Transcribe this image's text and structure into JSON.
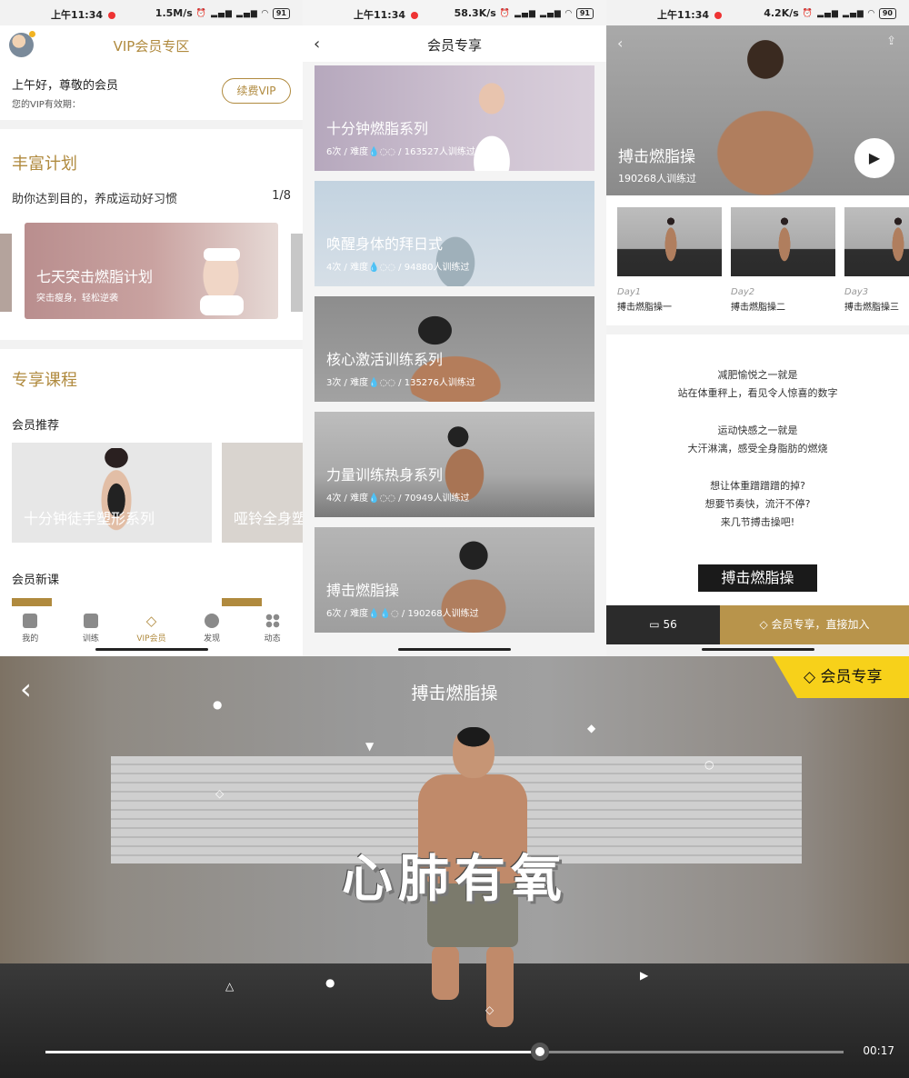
{
  "status": [
    {
      "time": "上午11:34",
      "speed": "1.5M/s",
      "battery": "91"
    },
    {
      "time": "上午11:34",
      "speed": "58.3K/s",
      "battery": "91"
    },
    {
      "time": "上午11:34",
      "speed": "4.2K/s",
      "battery": "90"
    }
  ],
  "p1": {
    "title": "VIP会员专区",
    "greeting": "上午好，尊敬的会员",
    "validity": "您的VIP有效期：",
    "renew": "续费VIP",
    "plans_title": "丰富计划",
    "plans_subtitle": "助你达到目的，养成运动好习惯",
    "plans_count": "1/8",
    "plan": {
      "title": "七天突击燃脂计划",
      "subtitle": "突击瘦身，轻松逆袭"
    },
    "courses_title": "专享课程",
    "recommend_label": "会员推荐",
    "recommend": [
      {
        "title": "十分钟徒手塑形系列"
      },
      {
        "title": "哑铃全身塑"
      }
    ],
    "new_label": "会员新课",
    "tabs": [
      {
        "label": "我的",
        "icon": "person-icon"
      },
      {
        "label": "训练",
        "icon": "dumbbell-icon"
      },
      {
        "label": "VIP会员",
        "icon": "diamond-icon"
      },
      {
        "label": "发现",
        "icon": "compass-icon"
      },
      {
        "label": "动态",
        "icon": "grid-dots-icon"
      }
    ]
  },
  "p2": {
    "title": "会员专享",
    "series": [
      {
        "title": "十分钟燃脂系列",
        "meta": "6次 / 难度💧◌◌ / 163527人训练过"
      },
      {
        "title": "唤醒身体的拜日式",
        "meta": "4次 / 难度💧◌◌ / 94880人训练过"
      },
      {
        "title": "核心激活训练系列",
        "meta": "3次 / 难度💧◌◌ / 135276人训练过"
      },
      {
        "title": "力量训练热身系列",
        "meta": "4次 / 难度💧◌◌ / 70949人训练过"
      },
      {
        "title": "搏击燃脂操",
        "meta": "6次 / 难度💧💧◌ / 190268人训练过"
      }
    ]
  },
  "p3": {
    "title": "搏击燃脂操",
    "trained": "190268人训练过",
    "days": [
      {
        "day": "Day1",
        "name": "搏击燃脂操一"
      },
      {
        "day": "Day2",
        "name": "搏击燃脂操二"
      },
      {
        "day": "Day3",
        "name": "搏击燃脂操三"
      }
    ],
    "desc": [
      "减肥愉悦之一就是",
      "站在体重秤上，看见令人惊喜的数字",
      "运动快感之一就是",
      "大汗淋漓，感受全身脂肪的燃烧",
      "想让体重蹭蹭蹭的掉?",
      "想要节奏快，流汗不停?",
      "来几节搏击操吧!"
    ],
    "tag": "搏击燃脂操",
    "comments": "56",
    "join": "会员专享，直接加入"
  },
  "p4": {
    "title": "搏击燃脂操",
    "badge": "会员专享",
    "overlay": "心肺有氧",
    "time": "00:17",
    "progress": 0.62
  },
  "colors": {
    "gold": "#b08a3e",
    "vip_yellow": "#f7d11a",
    "join": "#b8944b"
  }
}
